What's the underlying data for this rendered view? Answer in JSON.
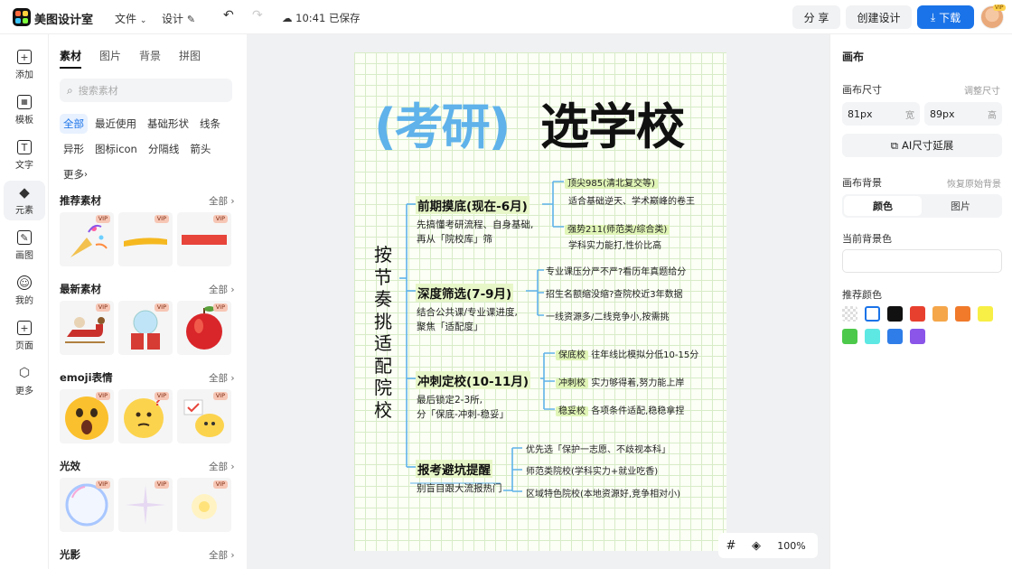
{
  "app": {
    "brand": "美图设计室"
  },
  "topbar": {
    "file_menu": "文件",
    "design_menu": "设计",
    "save_status": "10:41 已保存",
    "share_label": "分 享",
    "create_label": "创建设计",
    "download_label": "下载",
    "avatar_badge": "VIP",
    "accent": "#1a73e8"
  },
  "rail": {
    "items": [
      {
        "label": "添加",
        "icon": "plus-icon"
      },
      {
        "label": "模板",
        "icon": "template-icon"
      },
      {
        "label": "文字",
        "icon": "text-icon"
      },
      {
        "label": "元素",
        "icon": "shapes-icon"
      },
      {
        "label": "画图",
        "icon": "pen-icon"
      },
      {
        "label": "我的",
        "icon": "user-icon"
      },
      {
        "label": "页面",
        "icon": "page-icon"
      },
      {
        "label": "更多",
        "icon": "cube-icon"
      }
    ],
    "active_index": 3
  },
  "panel": {
    "tabs": [
      "素材",
      "图片",
      "背景",
      "拼图"
    ],
    "active_tab": 0,
    "search_placeholder": "搜索素材",
    "chips": [
      "全部",
      "最近使用",
      "基础形状",
      "线条",
      "异形",
      "图标icon",
      "分隔线",
      "箭头",
      "更多"
    ],
    "active_chip": 0,
    "sections": [
      {
        "title": "推荐素材",
        "all": "全部",
        "items": [
          "party-popper",
          "yellow-stroke",
          "red-bar"
        ]
      },
      {
        "title": "最新素材",
        "all": "全部",
        "items": [
          "sleigh",
          "gift-snowglobe",
          "apple"
        ]
      },
      {
        "title": "emoji表情",
        "all": "全部",
        "items": [
          "shocked-face",
          "thinking-face",
          "chick-with-sign"
        ]
      },
      {
        "title": "光效",
        "all": "全部",
        "items": [
          "bubble-ring",
          "sparkle-star",
          "glow"
        ]
      },
      {
        "title": "光影",
        "all": "全部",
        "items": []
      }
    ],
    "vip_badge": "VIP"
  },
  "canvas": {
    "zoom": "100%",
    "mindmap": {
      "title_part1": "(考研)",
      "title_part2": "选学校",
      "root": "按节奏挑适配院校",
      "branches": [
        {
          "title": "前期摸底(现在-6月)",
          "desc": "先搞懂考研流程、自身基础,\n再从「院校库」筛",
          "leaves": [
            {
              "tag": "顶尖985(清北复交等)",
              "text": "适合基础逆天、学术巅峰的卷王"
            },
            {
              "tag": "强势211(师范类/综合类)",
              "text": "学科实力能打,性价比高"
            }
          ]
        },
        {
          "title": "深度筛选(7-9月)",
          "desc": "结合公共课/专业课进度,\n聚焦「适配度」",
          "leaves": [
            {
              "tag": "",
              "text": "专业课压分严不严?看历年真题给分"
            },
            {
              "tag": "",
              "text": "招生名额缩没缩?查院校近3年数据"
            },
            {
              "tag": "",
              "text": "一线资源多/二线竞争小,按需挑"
            }
          ]
        },
        {
          "title": "冲刺定校(10-11月)",
          "desc": "最后锁定2-3所,\n分「保底-冲刺-稳妥」",
          "leaves": [
            {
              "tag": "保底校",
              "text": "往年线比模拟分低10-15分"
            },
            {
              "tag": "冲刺校",
              "text": "实力够得着,努力能上岸"
            },
            {
              "tag": "稳妥校",
              "text": "各项条件适配,稳稳拿捏"
            }
          ]
        },
        {
          "title": "报考避坑提醒",
          "desc": "别盲目跟大流报热门",
          "leaves": [
            {
              "tag": "",
              "text": "优先选「保护一志愿、不歧视本科」"
            },
            {
              "tag": "",
              "text": "师范类院校(学科实力+就业吃香)"
            },
            {
              "tag": "",
              "text": "区域特色院校(本地资源好,竞争相对小)"
            }
          ]
        }
      ]
    }
  },
  "rightpanel": {
    "header": "画布",
    "size_label": "画布尺寸",
    "size_hint": "调整尺寸",
    "width_value": "81px",
    "width_unit": "宽",
    "height_value": "89px",
    "height_unit": "高",
    "ai_extend": "AI尺寸延展",
    "bg_label": "画布背景",
    "bg_hint": "恢复原始背景",
    "bg_tabs": [
      "颜色",
      "图片"
    ],
    "current_bg_label": "当前背景色",
    "recommend_label": "推荐颜色",
    "swatches": [
      "transparent",
      "#ffffff",
      "#111111",
      "#e8402f",
      "#f5a64a",
      "#f07a2a",
      "#f7ef45",
      "#4cc94a",
      "#5de8e4",
      "#2f7de8",
      "#8a55e8"
    ]
  }
}
